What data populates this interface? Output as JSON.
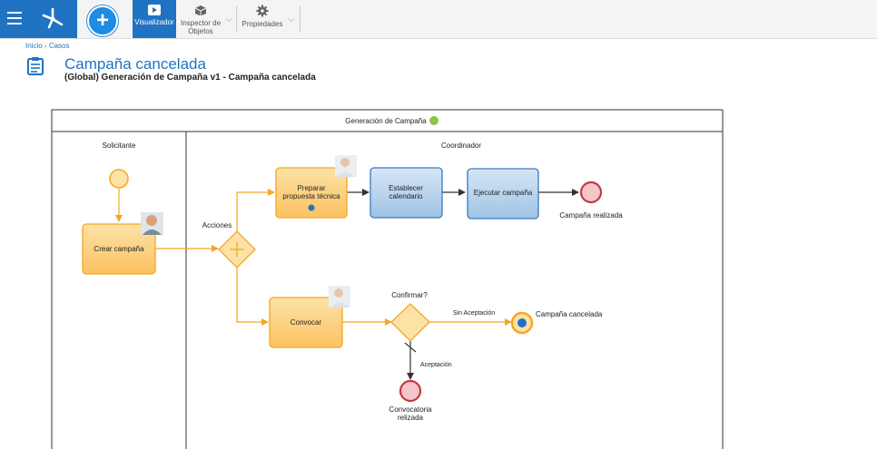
{
  "toolbar": {
    "visualizer_label": "Visualizador",
    "inspector_label_1": "Inspector de",
    "inspector_label_2": "Objetos",
    "properties_label": "Propiedades"
  },
  "breadcrumb": {
    "home": "Inicio",
    "separator": "›",
    "current": "Casos"
  },
  "page": {
    "title": "Campaña cancelada",
    "subtitle": "(Global) Generación de Campaña v1 - Campaña cancelada"
  },
  "diagram": {
    "pool_title": "Generación de Campaña",
    "lane_1": "Solicitante",
    "lane_2": "Coordinador",
    "task_crear": "Crear campaña",
    "task_preparar_1": "Preparar",
    "task_preparar_2": "propuesta técnica",
    "task_establecer_1": "Establecer",
    "task_establecer_2": "calendario",
    "task_ejecutar": "Ejecutar campaña",
    "task_convocar": "Convocar",
    "gateway_acciones": "Acciones",
    "gateway_confirmar": "Confirmar?",
    "flow_sin_aceptacion": "Sin Aceptación",
    "flow_aceptacion": "Aceptación",
    "end_realizada": "Campaña realizada",
    "end_cancelada": "Campaña cancelada",
    "end_convocatoria_1": "Convocatoria",
    "end_convocatoria_2": "relizada"
  },
  "colors": {
    "brand_blue": "#1f73c2",
    "task_orange": "#fcc96a",
    "task_blue": "#a9cbe8",
    "end_red": "#f4c6c9",
    "status_green": "#8dc641"
  }
}
